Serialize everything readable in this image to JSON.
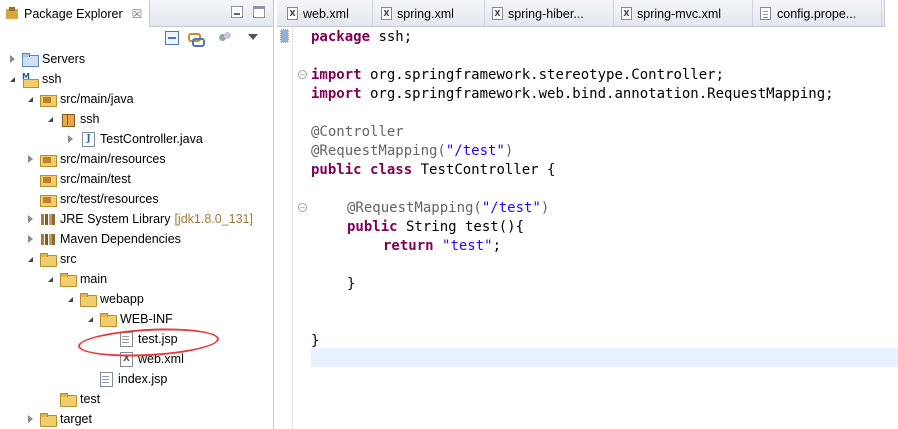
{
  "explorer": {
    "title": "Package Explorer",
    "close_glyph": "☒",
    "tree": [
      {
        "label": "Servers",
        "decor": ""
      },
      {
        "label": "ssh",
        "decor": ""
      },
      {
        "label": "src/main/java",
        "decor": ""
      },
      {
        "label": "ssh",
        "decor": ""
      },
      {
        "label": "TestController.java",
        "decor": ""
      },
      {
        "label": "src/main/resources",
        "decor": ""
      },
      {
        "label": "src/main/test",
        "decor": ""
      },
      {
        "label": "src/test/resources",
        "decor": ""
      },
      {
        "label": "JRE System Library",
        "decor": "[jdk1.8.0_131]"
      },
      {
        "label": "Maven Dependencies",
        "decor": ""
      },
      {
        "label": "src",
        "decor": ""
      },
      {
        "label": "main",
        "decor": ""
      },
      {
        "label": "webapp",
        "decor": ""
      },
      {
        "label": "WEB-INF",
        "decor": ""
      },
      {
        "label": "test.jsp",
        "decor": ""
      },
      {
        "label": "web.xml",
        "decor": ""
      },
      {
        "label": "index.jsp",
        "decor": ""
      },
      {
        "label": "test",
        "decor": ""
      },
      {
        "label": "target",
        "decor": ""
      }
    ]
  },
  "editor": {
    "tabs": [
      {
        "label": "web.xml"
      },
      {
        "label": "spring.xml"
      },
      {
        "label": "spring-hiber..."
      },
      {
        "label": "spring-mvc.xml"
      },
      {
        "label": "config.prope..."
      }
    ],
    "code": {
      "l1_kw": "package",
      "l1_rest": " ssh;",
      "l2_kw": "import",
      "l2_rest": " org.springframework.stereotype.Controller;",
      "l3_kw": "import",
      "l3_rest": " org.springframework.web.bind.annotation.RequestMapping;",
      "l4_ann": "@Controller",
      "l5_ann": "@RequestMapping(",
      "l5_str": "\"/test\"",
      "l5_end": ")",
      "l6_kw1": "public",
      "l6_kw2": "class",
      "l6_rest": " TestController {",
      "l7_ann": "@RequestMapping(",
      "l7_str": "\"/test\"",
      "l7_end": ")",
      "l8_kw": "public",
      "l8_rest": " String test(){",
      "l9_kw": "return",
      "l9_str": "\"test\"",
      "l9_end": ";",
      "l10": "}",
      "l11": "}"
    }
  }
}
